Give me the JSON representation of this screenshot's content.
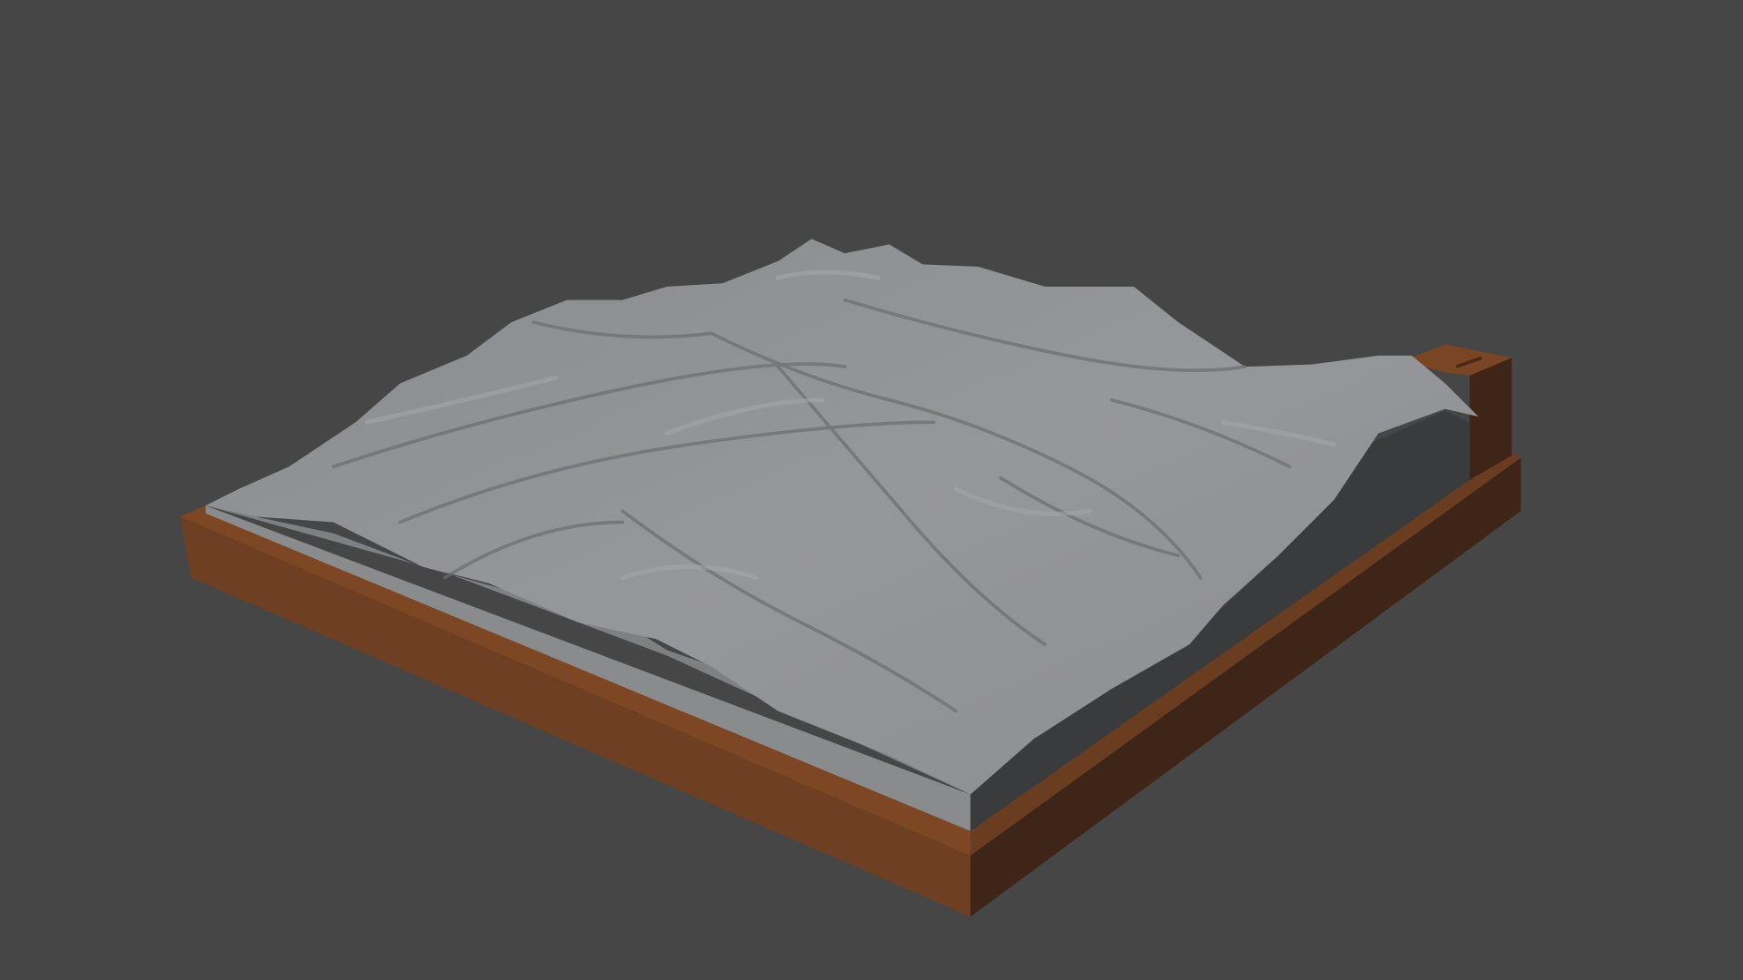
{
  "scene": {
    "background": "#464646",
    "terrain_color": "#8f9092",
    "terrain_shadow": "#6c6d70",
    "base_color": "#8a8b8d",
    "side_face_color": "#3a3b3d",
    "frame_top_color": "#7a4524",
    "frame_front_color": "#6e3f22",
    "frame_side_color": "#3e2518"
  }
}
